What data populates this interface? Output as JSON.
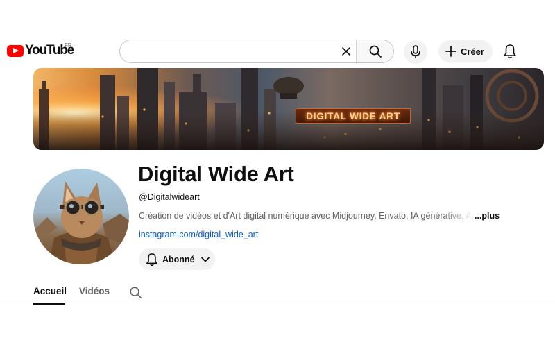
{
  "topbar": {
    "logo_text": "YouTube",
    "region": "FR",
    "search": {
      "value": "",
      "placeholder": ""
    },
    "create_label": "Créer"
  },
  "banner": {
    "sign_text": "DIGITAL WIDE ART"
  },
  "channel": {
    "name": "Digital Wide Art",
    "handle": "@Digitalwideart",
    "description": "Création de vidéos et d'Art digital numérique avec Midjourney, Envato, IA générative, Adobe",
    "more_label": "...plus",
    "link": "instagram.com/digital_wide_art",
    "subscribe_label": "Abonné"
  },
  "tabs": [
    {
      "label": "Accueil",
      "active": true
    },
    {
      "label": "Vidéos",
      "active": false
    }
  ],
  "colors": {
    "youtube_red": "#ff0000",
    "link_blue": "#065fd4",
    "button_bg": "#f2f2f2"
  },
  "icons": [
    "youtube-logo-icon",
    "clear-icon",
    "search-icon",
    "mic-icon",
    "plus-icon",
    "bell-icon",
    "chevron-down-icon"
  ]
}
